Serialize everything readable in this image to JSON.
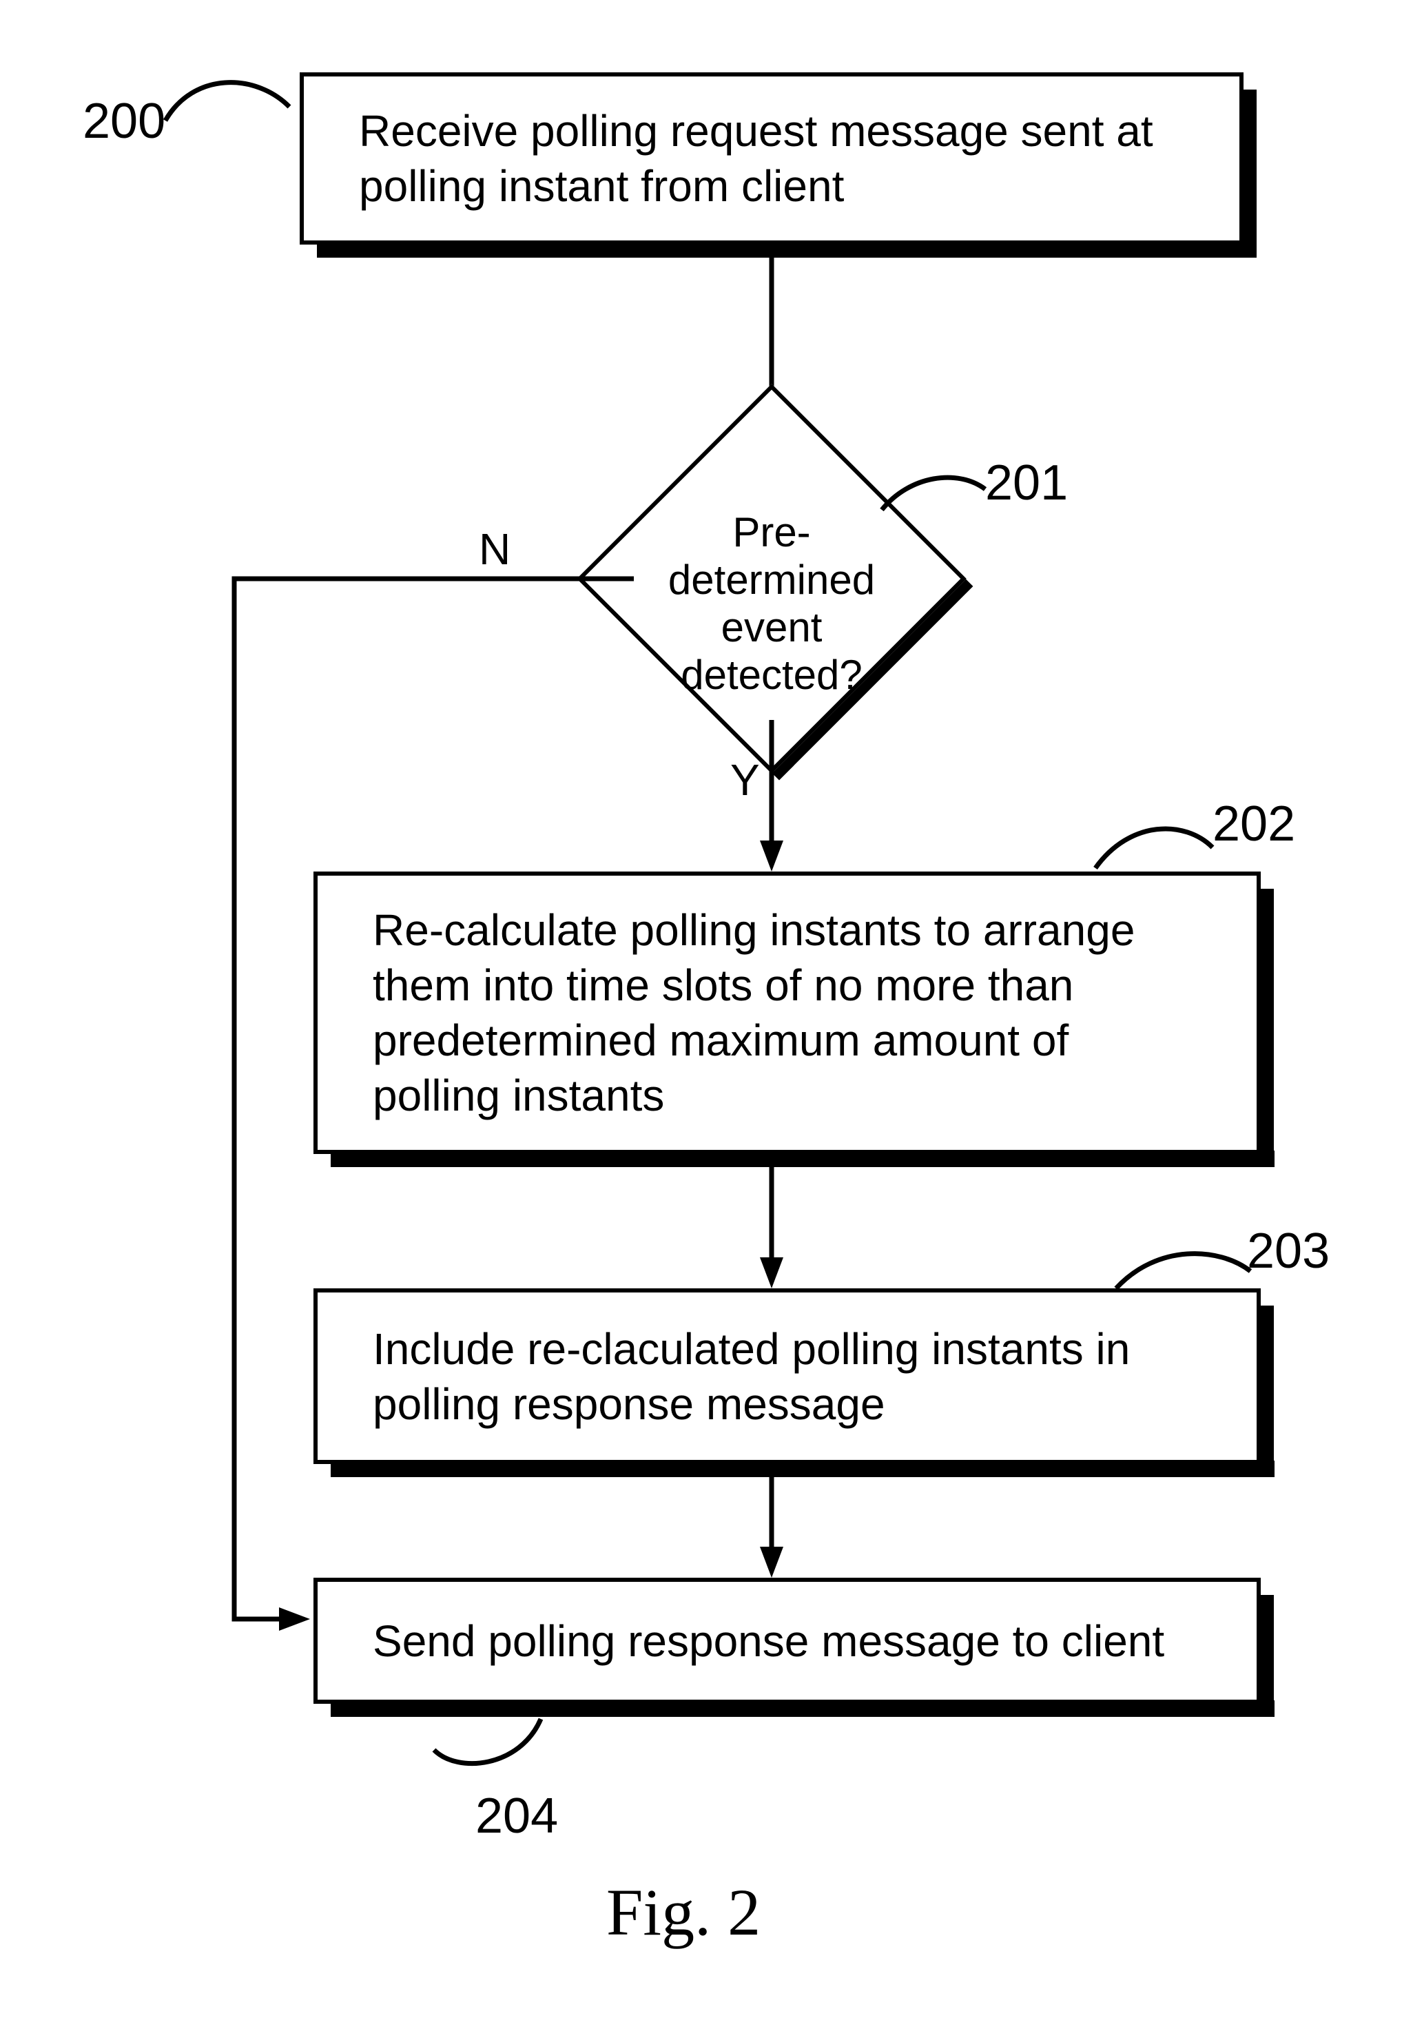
{
  "nodes": {
    "n200": {
      "ref": "200",
      "text": "Receive polling request message sent at polling instant from client"
    },
    "n201": {
      "ref": "201",
      "text": "Pre-\ndetermined\nevent\ndetected?"
    },
    "n202": {
      "ref": "202",
      "text": "Re-calculate polling instants to arrange them into time slots of no more than predetermined maximum amount of polling instants"
    },
    "n203": {
      "ref": "203",
      "text": "Include re-claculated polling instants in polling response message"
    },
    "n204": {
      "ref": "204",
      "text": "Send polling response message to client"
    }
  },
  "edges": {
    "yes": "Y",
    "no": "N"
  },
  "caption": "Fig. 2"
}
